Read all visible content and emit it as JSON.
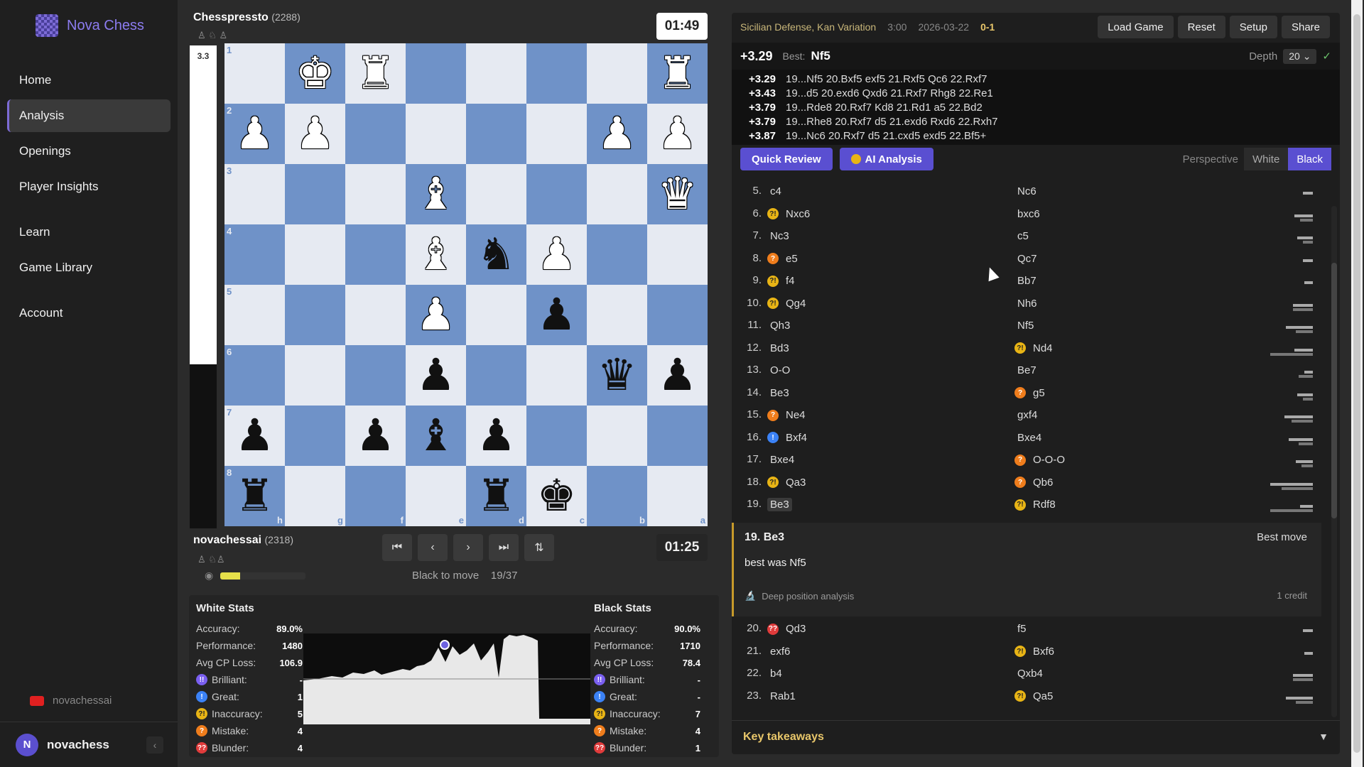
{
  "sidebar": {
    "brand": "Nova Chess",
    "items": [
      {
        "label": "Home"
      },
      {
        "label": "Analysis"
      },
      {
        "label": "Openings"
      },
      {
        "label": "Player Insights"
      },
      {
        "label": "Learn"
      },
      {
        "label": "Game Library"
      },
      {
        "label": "Account"
      }
    ],
    "channel": "novachessai",
    "user_initial": "N",
    "username": "novachess"
  },
  "board": {
    "top_player": {
      "name": "Chesspressto",
      "rating": "(2288)",
      "clock": "01:49"
    },
    "bottom_player": {
      "name": "novachessai",
      "rating": "(2318)",
      "clock": "01:25"
    },
    "eval_label": "3.3",
    "eval_white_fraction": 0.66,
    "accuracy_fill": 0.23,
    "to_move": "Black to move",
    "move_counter": "19/37",
    "ranks": [
      "1",
      "2",
      "3",
      "4",
      "5",
      "6",
      "7",
      "8"
    ],
    "files": [
      "h",
      "g",
      "f",
      "e",
      "d",
      "c",
      "b",
      "a"
    ],
    "position": [
      [
        "",
        "wK",
        "wR",
        "",
        "",
        "",
        "",
        "wR"
      ],
      [
        "wP",
        "wP",
        "",
        "",
        "",
        "",
        "wP",
        "wP"
      ],
      [
        "",
        "",
        "",
        "wB",
        "",
        "",
        "",
        "wQ"
      ],
      [
        "",
        "",
        "",
        "wB",
        "bN",
        "wP",
        "",
        ""
      ],
      [
        "",
        "",
        "",
        "wP",
        "",
        "bP",
        "",
        ""
      ],
      [
        "",
        "",
        "",
        "bP",
        "",
        "",
        "bQ",
        "bP"
      ],
      [
        "bP",
        "",
        "bP",
        "bB",
        "bP",
        "",
        "",
        ""
      ],
      [
        "bR",
        "",
        "",
        "",
        "bR",
        "bK",
        "",
        ""
      ]
    ]
  },
  "stats": {
    "white": {
      "title": "White Stats",
      "rows": [
        {
          "label": "Accuracy:",
          "value": "89.0%"
        },
        {
          "label": "Performance:",
          "value": "1480"
        },
        {
          "label": "Avg CP Loss:",
          "value": "106.9"
        },
        {
          "label": "Brilliant:",
          "value": "-",
          "badge": "brill",
          "icon": "!!"
        },
        {
          "label": "Great:",
          "value": "1",
          "badge": "great",
          "icon": "!"
        },
        {
          "label": "Inaccuracy:",
          "value": "5",
          "badge": "inacc",
          "icon": "?!"
        },
        {
          "label": "Mistake:",
          "value": "4",
          "badge": "mist",
          "icon": "?"
        },
        {
          "label": "Blunder:",
          "value": "4",
          "badge": "blund",
          "icon": "??"
        }
      ]
    },
    "black": {
      "title": "Black Stats",
      "rows": [
        {
          "label": "Accuracy:",
          "value": "90.0%"
        },
        {
          "label": "Performance:",
          "value": "1710"
        },
        {
          "label": "Avg CP Loss:",
          "value": "78.4"
        },
        {
          "label": "Brilliant:",
          "value": "-",
          "badge": "brill",
          "icon": "!!"
        },
        {
          "label": "Great:",
          "value": "-",
          "badge": "great",
          "icon": "!"
        },
        {
          "label": "Inaccuracy:",
          "value": "7",
          "badge": "inacc",
          "icon": "?!"
        },
        {
          "label": "Mistake:",
          "value": "4",
          "badge": "mist",
          "icon": "?"
        },
        {
          "label": "Blunder:",
          "value": "1",
          "badge": "blund",
          "icon": "??"
        }
      ]
    }
  },
  "panel": {
    "opening": "Sicilian Defense, Kan Variation",
    "time_control": "3:00",
    "date": "2026-03-22",
    "result": "0-1",
    "buttons": [
      "Load Game",
      "Reset",
      "Setup",
      "Share"
    ],
    "eval": "+3.29",
    "best_label": "Best:",
    "best_move": "Nf5",
    "depth_label": "Depth",
    "depth_value": "20",
    "lines": [
      {
        "eval": "+3.29",
        "moves": "19...Nf5 20.Bxf5 exf5 21.Rxf5 Qc6 22.Rxf7"
      },
      {
        "eval": "+3.43",
        "moves": "19...d5 20.exd6 Qxd6 21.Rxf7 Rhg8 22.Re1"
      },
      {
        "eval": "+3.79",
        "moves": "19...Rde8 20.Rxf7 Kd8 21.Rd1 a5 22.Bd2"
      },
      {
        "eval": "+3.79",
        "moves": "19...Rhe8 20.Rxf7 d5 21.exd6 Rxd6 22.Rxh7"
      },
      {
        "eval": "+3.87",
        "moves": "19...Nc6 20.Rxf7 d5 21.cxd5 exd5 22.Bf5+"
      }
    ],
    "quick_review": "Quick Review",
    "ai_analysis": "AI Analysis",
    "perspective_label": "Perspective",
    "perspective_white": "White",
    "perspective_black": "Black",
    "moves": [
      {
        "n": "5.",
        "w": "c4",
        "b": "Nc6"
      },
      {
        "n": "6.",
        "w": "Nxc6",
        "wb": "inacc",
        "b": "bxc6"
      },
      {
        "n": "7.",
        "w": "Nc3",
        "b": "c5"
      },
      {
        "n": "8.",
        "w": "e5",
        "wb": "mist",
        "b": "Qc7"
      },
      {
        "n": "9.",
        "w": "f4",
        "wb": "inacc",
        "b": "Bb7"
      },
      {
        "n": "10.",
        "w": "Qg4",
        "wb": "inacc",
        "b": "Nh6"
      },
      {
        "n": "11.",
        "w": "Qh3",
        "b": "Nf5"
      },
      {
        "n": "12.",
        "w": "Bd3",
        "b": "Nd4",
        "bb": "inacc"
      },
      {
        "n": "13.",
        "w": "O-O",
        "b": "Be7"
      },
      {
        "n": "14.",
        "w": "Be3",
        "b": "g5",
        "bb": "mist"
      },
      {
        "n": "15.",
        "w": "Ne4",
        "wb": "mist",
        "b": "gxf4"
      },
      {
        "n": "16.",
        "w": "Bxf4",
        "wb": "great",
        "b": "Bxe4"
      },
      {
        "n": "17.",
        "w": "Bxe4",
        "b": "O-O-O",
        "bb": "mist"
      },
      {
        "n": "18.",
        "w": "Qa3",
        "wb": "inacc",
        "b": "Qb6",
        "bb": "mist"
      },
      {
        "n": "19.",
        "w": "Be3",
        "b": "Rdf8",
        "bb": "inacc"
      }
    ],
    "moves_after": [
      {
        "n": "20.",
        "w": "Qd3",
        "wb": "blund",
        "b": "f5"
      },
      {
        "n": "21.",
        "w": "exf6",
        "b": "Bxf6",
        "bb": "inacc"
      },
      {
        "n": "22.",
        "w": "b4",
        "b": "Qxb4"
      },
      {
        "n": "23.",
        "w": "Rab1",
        "b": "Qa5",
        "bb": "inacc"
      }
    ],
    "detail": {
      "move": "19. Be3",
      "tag": "Best move",
      "text": "best was Nf5",
      "deep": "Deep position analysis",
      "credit": "1 credit"
    },
    "takeaways": "Key takeaways"
  },
  "icons": {
    "first": "⏮",
    "prev": "‹",
    "next": "›",
    "last": "⏭",
    "flip": "⇅",
    "eye": "◉",
    "collapse": "‹",
    "dropdown": "⌄",
    "check": "✓",
    "microscope": "🔬",
    "arrow-down": "▼"
  },
  "colors": {
    "accent": "#5a4fd1",
    "light_square": "#e6eaf2",
    "dark_square": "#6f92c8"
  }
}
